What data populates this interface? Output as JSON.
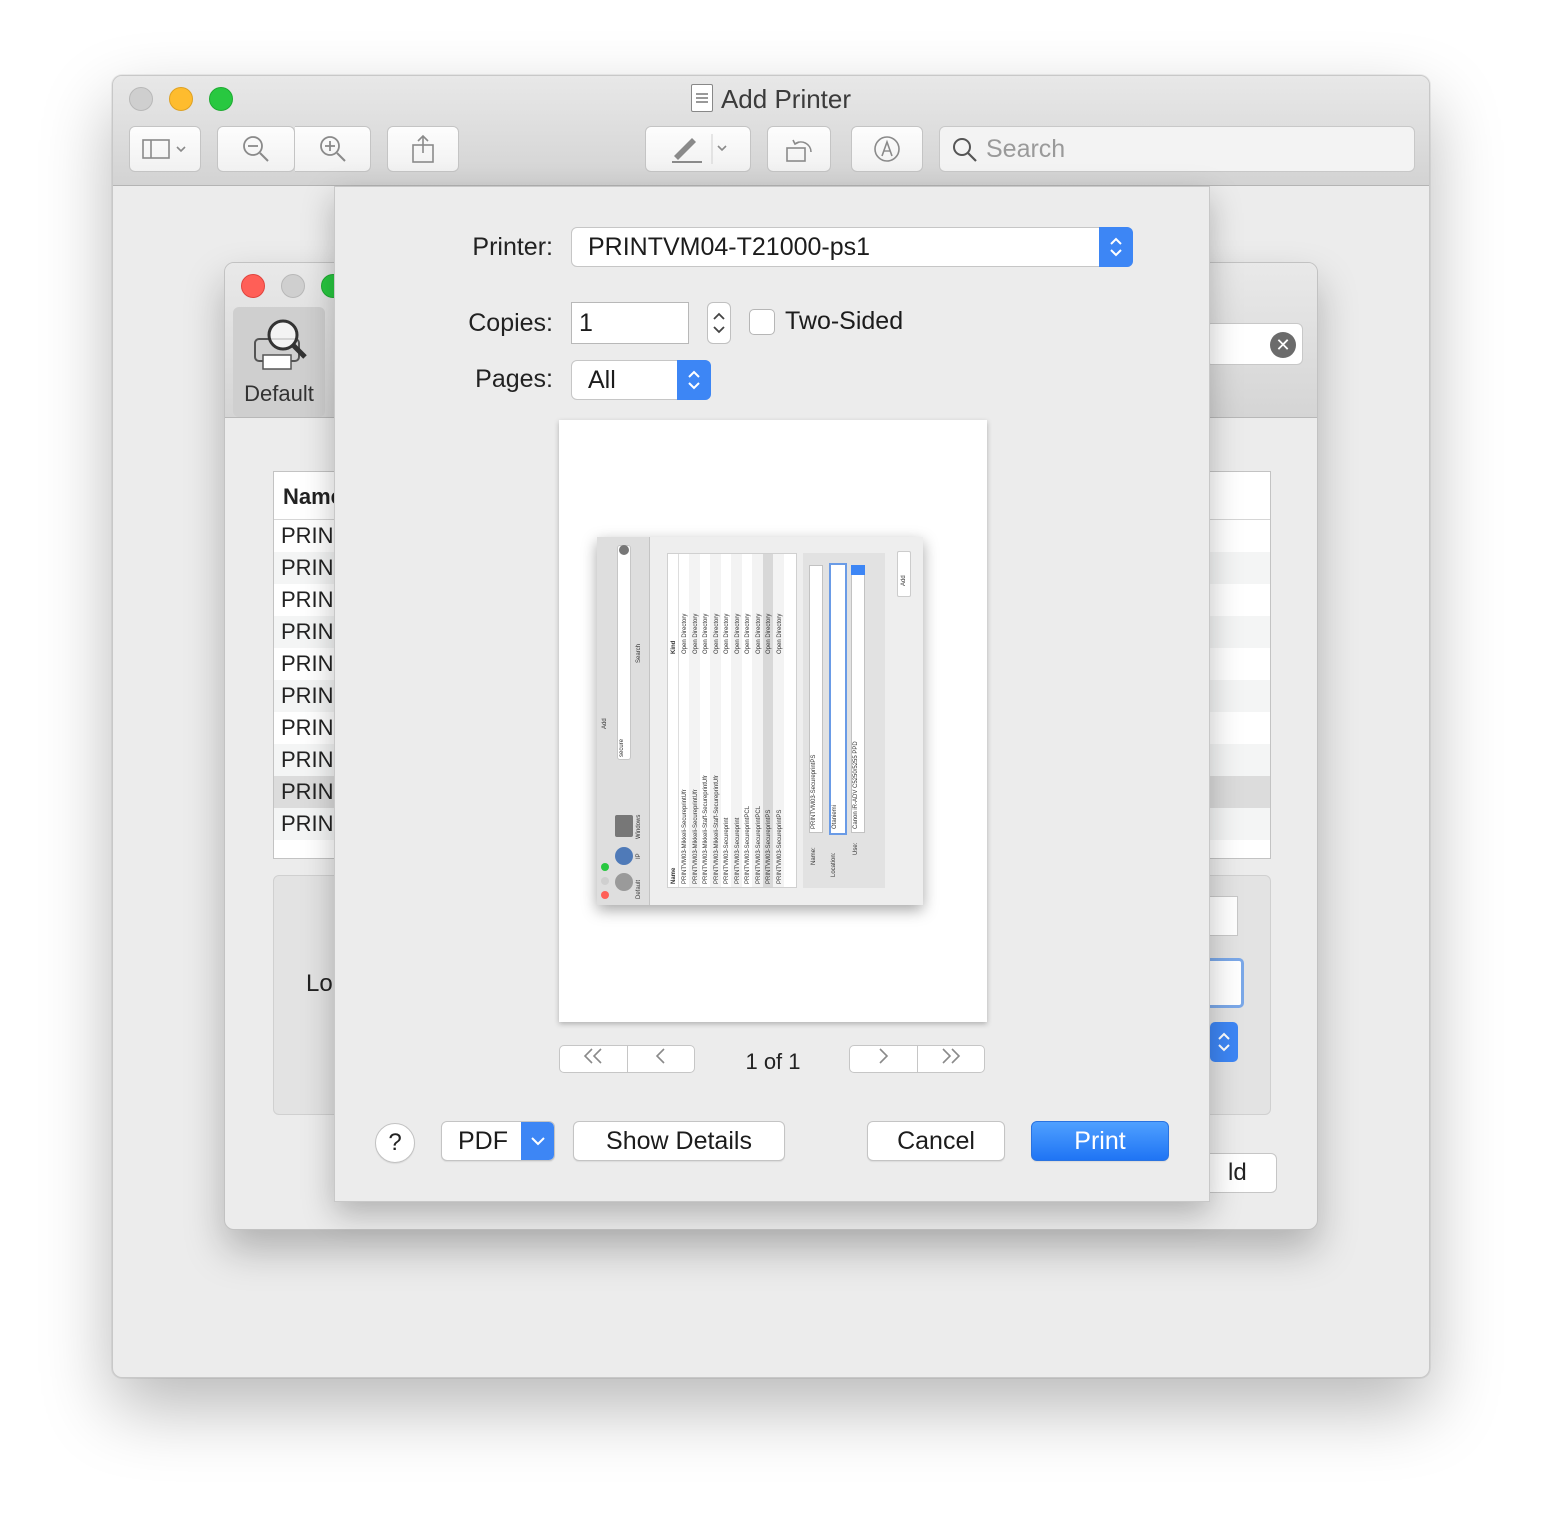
{
  "main_window": {
    "title": "Add Printer",
    "search_placeholder": "Search"
  },
  "add_printer_window": {
    "tab_default_label": "Default",
    "list_header": "Name",
    "list_rows": [
      "PRINT",
      "PRINT",
      "PRINT",
      "PRINT",
      "PRINT",
      "PRINT",
      "PRINT",
      "PRINT",
      "PRINT",
      "PRINT"
    ],
    "location_label": "Lo",
    "add_button_label": "ld"
  },
  "print_sheet": {
    "printer_label": "Printer:",
    "printer_value": "PRINTVM04-T21000-ps1",
    "copies_label": "Copies:",
    "copies_value": "1",
    "two_sided_label": "Two-Sided",
    "two_sided_checked": false,
    "pages_label": "Pages:",
    "pages_value": "All",
    "page_indicator": "1 of 1",
    "help_label": "?",
    "pdf_label": "PDF",
    "show_details_label": "Show Details",
    "cancel_label": "Cancel",
    "print_label": "Print"
  },
  "thumbnail": {
    "list_header_name": "Name",
    "list_header_kind": "Kind",
    "rows": [
      "PRINTVM03-Mikkeli-SecureprintUfr",
      "PRINTVM03-Mikkeli-SecureprintUfr",
      "PRINTVM03-Mikkeli-Staff-SecureprintUfr",
      "PRINTVM03-Mikkeli-Staff-SecureprintUfr",
      "PRINTVM03-Secureprint",
      "PRINTVM03-Secureprint",
      "PRINTVM03-SecureprintPCL",
      "PRINTVM03-SecureprintPCL",
      "PRINTVM03-SecureprintPS",
      "PRINTVM03-SecureprintPS"
    ],
    "kind": "Open Directory",
    "name_label": "Name:",
    "name_value": "PRINTVM03-SecureprintPS",
    "location_label": "Location:",
    "location_value": "Otaniemi",
    "use_label": "Use:",
    "use_value": "Canon iR-ADV C5250/5255 PPD",
    "add_label": "Add",
    "search_text": "secure",
    "search_label": "Search",
    "tab_default": "Default",
    "tab_ip": "IP",
    "tab_windows": "Windows"
  },
  "colors": {
    "accent": "#3d86f5",
    "close_red": "#ff5f57",
    "minimize_yellow": "#febc2e",
    "zoom_green": "#28c840"
  }
}
